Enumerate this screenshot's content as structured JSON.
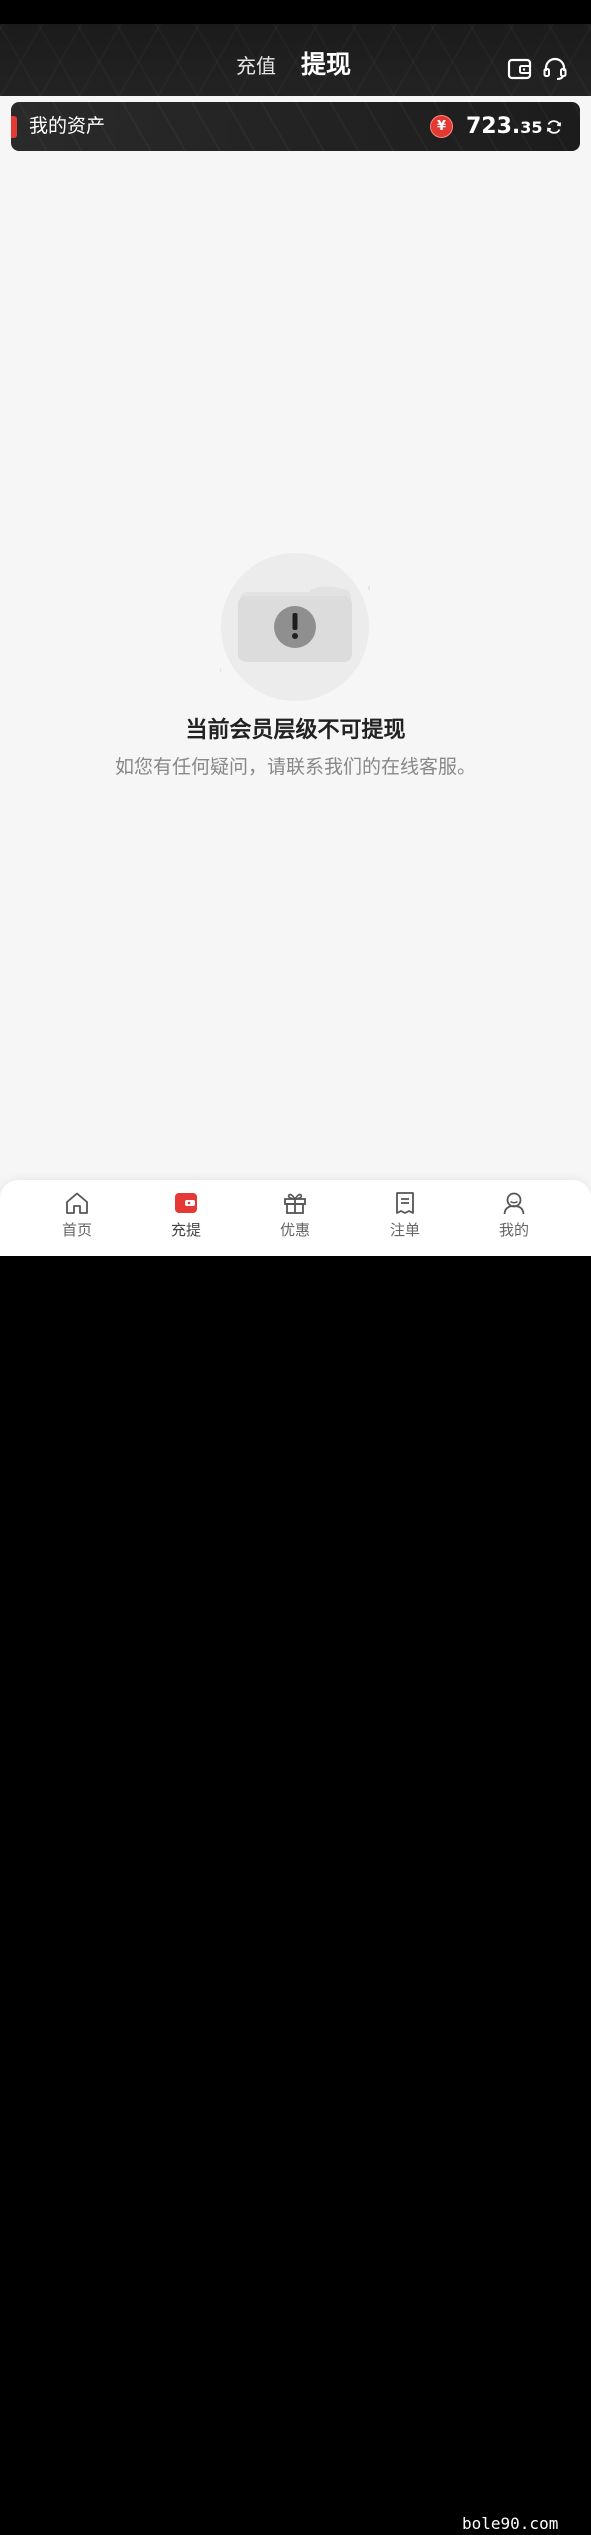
{
  "header": {
    "tab_recharge": "充值",
    "tab_withdraw": "提现",
    "icons": [
      "wallet-icon",
      "headset-icon"
    ]
  },
  "assets": {
    "label": "我的资产",
    "currency_symbol": "¥",
    "balance_integer": "723.",
    "balance_decimal": "35",
    "accent_color": "#e53935"
  },
  "empty_state": {
    "title": "当前会员层级不可提现",
    "subtitle": "如您有任何疑问，请联系我们的在线客服。",
    "icon": "exclamation-icon"
  },
  "bottom_nav": {
    "items": [
      {
        "label": "首页",
        "icon": "home-icon"
      },
      {
        "label": "充提",
        "icon": "wallet-icon",
        "active": true
      },
      {
        "label": "优惠",
        "icon": "gift-icon"
      },
      {
        "label": "注单",
        "icon": "document-icon"
      },
      {
        "label": "我的",
        "icon": "user-icon"
      }
    ]
  },
  "watermark": "bole90.com",
  "colors": {
    "header_bg": "#1e1e1e",
    "page_bg": "#f6f6f6",
    "accent_red": "#e53935"
  }
}
